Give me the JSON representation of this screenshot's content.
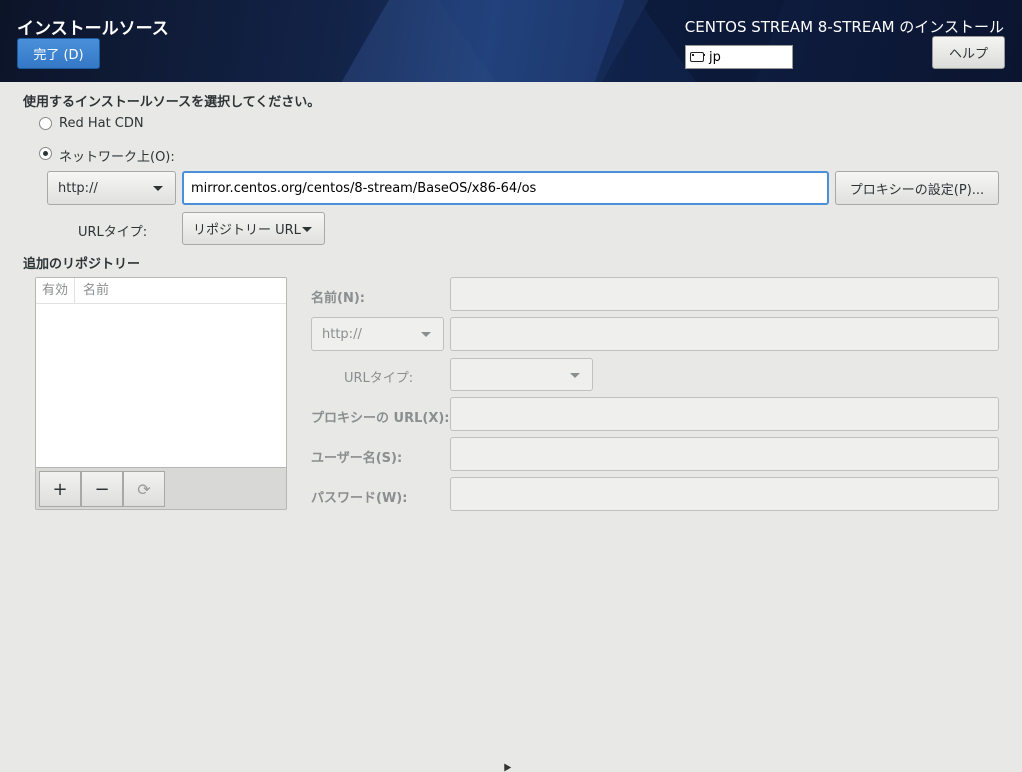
{
  "header": {
    "title": "インストールソース",
    "done_label": "完了 (D)",
    "product_title": "CENTOS STREAM 8-STREAM のインストール",
    "keyboard_layout": "jp",
    "help_label": "ヘルプ"
  },
  "source": {
    "prompt": "使用するインストールソースを選択してください。",
    "cdn_label": "Red Hat CDN",
    "network_label": "ネットワーク上(O):",
    "selected": "network",
    "protocol": "http://",
    "url_value": "mirror.centos.org/centos/8-stream/BaseOS/x86-64/os",
    "proxy_button": "プロキシーの設定(P)...",
    "url_type_label": "URLタイプ:",
    "url_type_value": "リポジトリー URL"
  },
  "additional": {
    "heading": "追加のリポジトリー",
    "columns": [
      "有効",
      "名前"
    ],
    "add_label": "+",
    "remove_label": "−",
    "refresh_label": "⟳",
    "name_label": "名前(N):",
    "protocol": "http://",
    "url_type_label": "URLタイプ:",
    "proxy_url_label": "プロキシーの URL(X):",
    "username_label": "ユーザー名(S):",
    "password_label": "パスワード(W):"
  }
}
